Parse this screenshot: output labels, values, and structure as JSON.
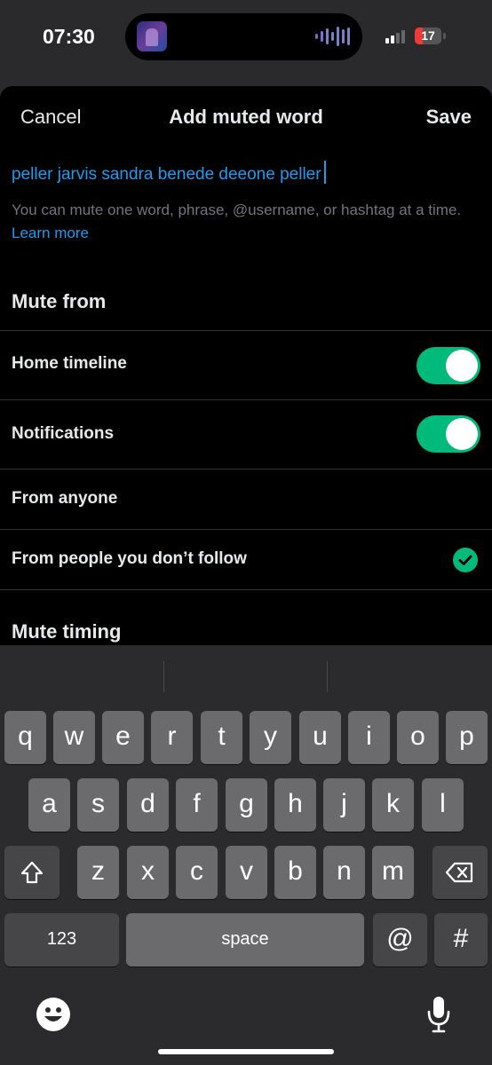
{
  "status": {
    "time": "07:30",
    "battery": "17"
  },
  "nav": {
    "cancel": "Cancel",
    "title": "Add muted word",
    "save": "Save"
  },
  "input": {
    "value": "peller jarvis sandra benede deeone peller"
  },
  "hint": {
    "text": "You can mute one word, phrase, @username, or hashtag at a time.",
    "link": "Learn more"
  },
  "mute_from": {
    "title": "Mute from",
    "home_timeline": {
      "label": "Home timeline",
      "on": true
    },
    "notifications": {
      "label": "Notifications",
      "on": true
    },
    "from_anyone": {
      "label": "From anyone",
      "selected": false
    },
    "from_people": {
      "label": "From people you don’t follow",
      "selected": true
    }
  },
  "mute_timing": {
    "title": "Mute timing"
  },
  "keyboard": {
    "row1": [
      "q",
      "w",
      "e",
      "r",
      "t",
      "y",
      "u",
      "i",
      "o",
      "p"
    ],
    "row2": [
      "a",
      "s",
      "d",
      "f",
      "g",
      "h",
      "j",
      "k",
      "l"
    ],
    "row3": [
      "z",
      "x",
      "c",
      "v",
      "b",
      "n",
      "m"
    ],
    "numbers_label": "123",
    "space_label": "space",
    "at_label": "@",
    "hash_label": "#"
  },
  "colors": {
    "accent": "#1d9bf0",
    "toggle": "#00ba7c",
    "background": "#000000"
  }
}
